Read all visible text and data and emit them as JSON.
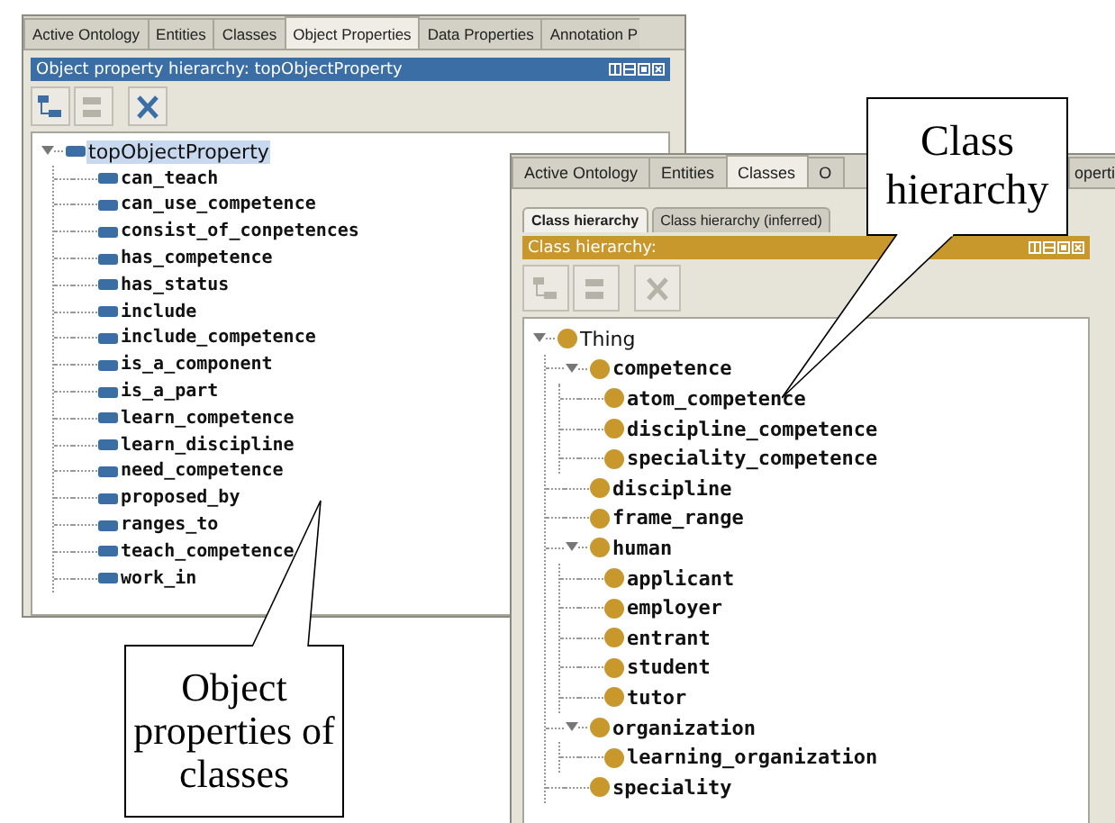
{
  "windows": [
    {
      "kind": "properties",
      "tabs": [
        {
          "label": "Active Ontology",
          "selected": false
        },
        {
          "label": "Entities",
          "selected": false
        },
        {
          "label": "Classes",
          "selected": false
        },
        {
          "label": "Object Properties",
          "selected": true
        },
        {
          "label": "Data Properties",
          "selected": false
        },
        {
          "label": "Annotation P",
          "selected": false
        }
      ],
      "panel_title": "Object property hierarchy: topObjectProperty",
      "toolbar": [
        {
          "kind": "add_child",
          "disabled": false
        },
        {
          "kind": "add_sibling",
          "disabled": true
        },
        {
          "kind": "delete",
          "disabled": false
        }
      ],
      "tree": [
        {
          "label": "topObjectProperty",
          "selected": true,
          "expanded": true,
          "children": [
            {
              "label": "can_teach",
              "selected": false
            },
            {
              "label": "can_use_competence",
              "selected": false
            },
            {
              "label": "consist_of_conpetences",
              "selected": false
            },
            {
              "label": "has_competence",
              "selected": false
            },
            {
              "label": "has_status",
              "selected": false
            },
            {
              "label": "include",
              "selected": false
            },
            {
              "label": "include_competence",
              "selected": false
            },
            {
              "label": "is_a_component",
              "selected": false
            },
            {
              "label": "is_a_part",
              "selected": false
            },
            {
              "label": "learn_competence",
              "selected": false
            },
            {
              "label": "learn_discipline",
              "selected": false
            },
            {
              "label": "need_competence",
              "selected": false
            },
            {
              "label": "proposed_by",
              "selected": false
            },
            {
              "label": "ranges_to",
              "selected": false
            },
            {
              "label": "teach_competence",
              "selected": false
            },
            {
              "label": "work_in",
              "selected": false
            }
          ]
        }
      ]
    },
    {
      "kind": "classes",
      "tabs": [
        {
          "label": "Active Ontology",
          "selected": false
        },
        {
          "label": "Entities",
          "selected": false
        },
        {
          "label": "Classes",
          "selected": true
        },
        {
          "label": "O",
          "selected": false
        },
        {
          "label": "operti",
          "selected": false
        }
      ],
      "subtabs": [
        {
          "label": "Class hierarchy",
          "selected": true
        },
        {
          "label": "Class hierarchy (inferred)",
          "selected": false
        }
      ],
      "panel_title": "Class hierarchy:",
      "toolbar": [
        {
          "kind": "add_child",
          "disabled": true
        },
        {
          "kind": "add_sibling",
          "disabled": true
        },
        {
          "kind": "delete",
          "disabled": true
        }
      ],
      "tree": [
        {
          "label": "Thing",
          "selected": false,
          "expanded": true,
          "children": [
            {
              "label": "competence",
              "selected": false,
              "expanded": true,
              "children": [
                {
                  "label": "atom_competence",
                  "selected": false
                },
                {
                  "label": "discipline_competence",
                  "selected": false
                },
                {
                  "label": "speciality_competence",
                  "selected": false
                }
              ]
            },
            {
              "label": "discipline",
              "selected": false
            },
            {
              "label": "frame_range",
              "selected": false
            },
            {
              "label": "human",
              "selected": false,
              "expanded": true,
              "children": [
                {
                  "label": "applicant",
                  "selected": false
                },
                {
                  "label": "employer",
                  "selected": false
                },
                {
                  "label": "entrant",
                  "selected": false
                },
                {
                  "label": "student",
                  "selected": false
                },
                {
                  "label": "tutor",
                  "selected": false
                }
              ]
            },
            {
              "label": "organization",
              "selected": false,
              "expanded": true,
              "children": [
                {
                  "label": "learning_organization",
                  "selected": false
                }
              ]
            },
            {
              "label": "speciality",
              "selected": false
            }
          ]
        }
      ]
    }
  ],
  "callouts": [
    {
      "text": "Class hierarchy"
    },
    {
      "text": "Object properties of classes"
    }
  ]
}
